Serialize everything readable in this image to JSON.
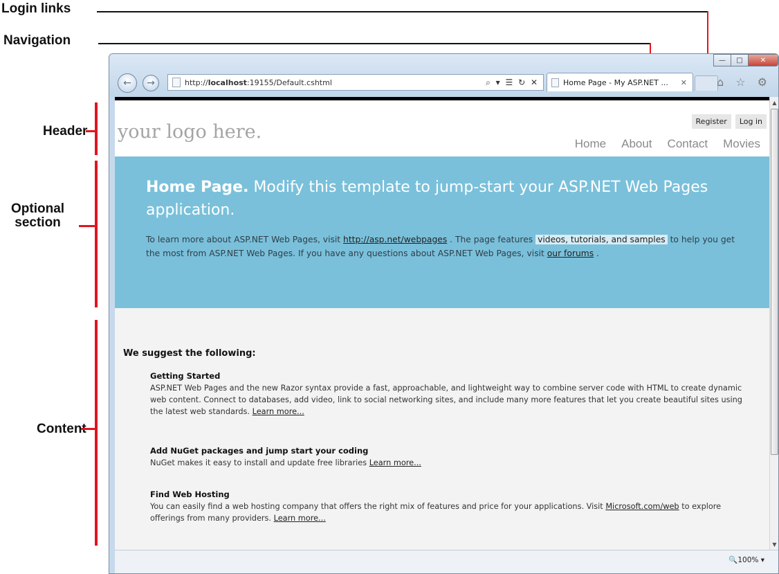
{
  "annotations": {
    "login_links": "Login links",
    "navigation": "Navigation",
    "header": "Header",
    "optional_section": "Optional\nsection",
    "content": "Content"
  },
  "browser": {
    "url_prefix": "http://",
    "url_host": "localhost",
    "url_rest": ":19155/Default.cshtml",
    "address_tools": "⌕ ▾ ☰ ↻ ✕",
    "tab_title": "Home Page - My ASP.NET ...",
    "tab_close": "✕",
    "command_icons": "⌂ ☆ ⚙",
    "zoom": "🔍100%  ▾"
  },
  "header": {
    "logo": "your logo here.",
    "login_links": [
      "Register",
      "Log in"
    ],
    "nav": [
      "Home",
      "About",
      "Contact",
      "Movies"
    ]
  },
  "featured": {
    "title_bold": "Home Page.",
    "title_rest": " Modify this template to jump-start your ASP.NET Web Pages application.",
    "text_1": "To learn more about ASP.NET Web Pages, visit ",
    "link_1": "http://asp.net/webpages",
    "text_2": " . The page features ",
    "highlight": "videos, tutorials, and samples",
    "text_3": " to help you get the most from ASP.NET Web Pages. If you have any questions about ASP.NET Web Pages, visit ",
    "link_2": "our forums",
    "text_4": " ."
  },
  "content": {
    "heading": "We suggest the following:",
    "suggestions": [
      {
        "title": "Getting Started",
        "text": "ASP.NET Web Pages and the new Razor syntax provide a fast, approachable, and lightweight way to combine server code with HTML to create dynamic web content. Connect to databases, add video, link to social networking sites, and include many more features that let you create beautiful sites using the latest web standards. ",
        "link": "Learn more..."
      },
      {
        "title": "Add NuGet packages and jump start your coding",
        "text": "NuGet makes it easy to install and update free libraries ",
        "link": "Learn more..."
      },
      {
        "title": "Find Web Hosting",
        "text": "You can easily find a web hosting company that offers the right mix of features and price for your applications. Visit ",
        "link_inline": "Microsoft.com/web",
        "text_after": " to explore offerings from many providers. ",
        "link": "Learn more..."
      }
    ]
  },
  "colors": {
    "annotation_red": "#e0151f",
    "featured_bg": "#7ac0da",
    "content_bg": "#f3f3f3"
  }
}
